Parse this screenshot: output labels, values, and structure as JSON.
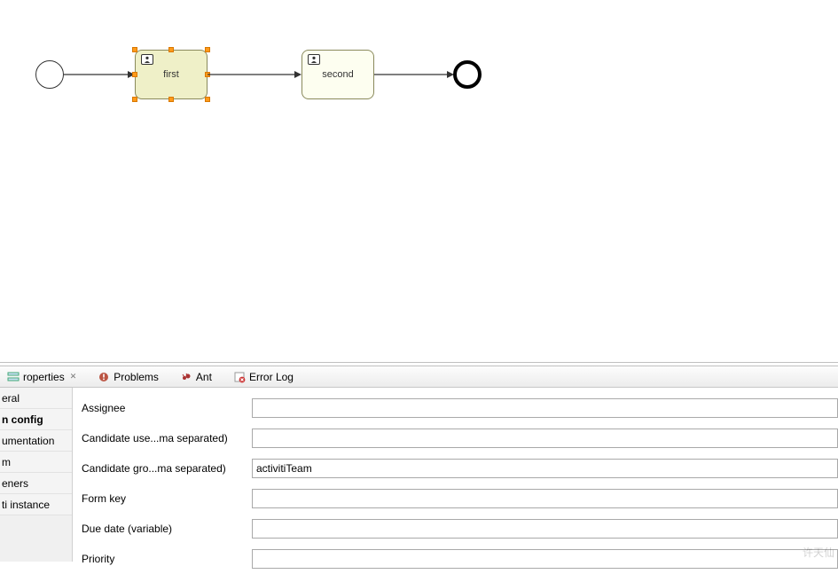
{
  "diagram": {
    "task1_label": "first",
    "task2_label": "second"
  },
  "tabs": {
    "properties": "roperties",
    "problems": "Problems",
    "ant": "Ant",
    "errorlog": "Error Log"
  },
  "sidebar": {
    "items": [
      "eral",
      "n config",
      "umentation",
      "m",
      "eners",
      "ti instance"
    ]
  },
  "form": {
    "assignee": {
      "label": "Assignee",
      "value": ""
    },
    "candidate_users": {
      "label": "Candidate use...ma separated)",
      "value": ""
    },
    "candidate_groups": {
      "label": "Candidate gro...ma separated)",
      "value": "activitiTeam"
    },
    "form_key": {
      "label": "Form key",
      "value": ""
    },
    "due_date": {
      "label": "Due date (variable)",
      "value": ""
    },
    "priority": {
      "label": "Priority",
      "value": ""
    }
  },
  "watermark": "许天仙"
}
